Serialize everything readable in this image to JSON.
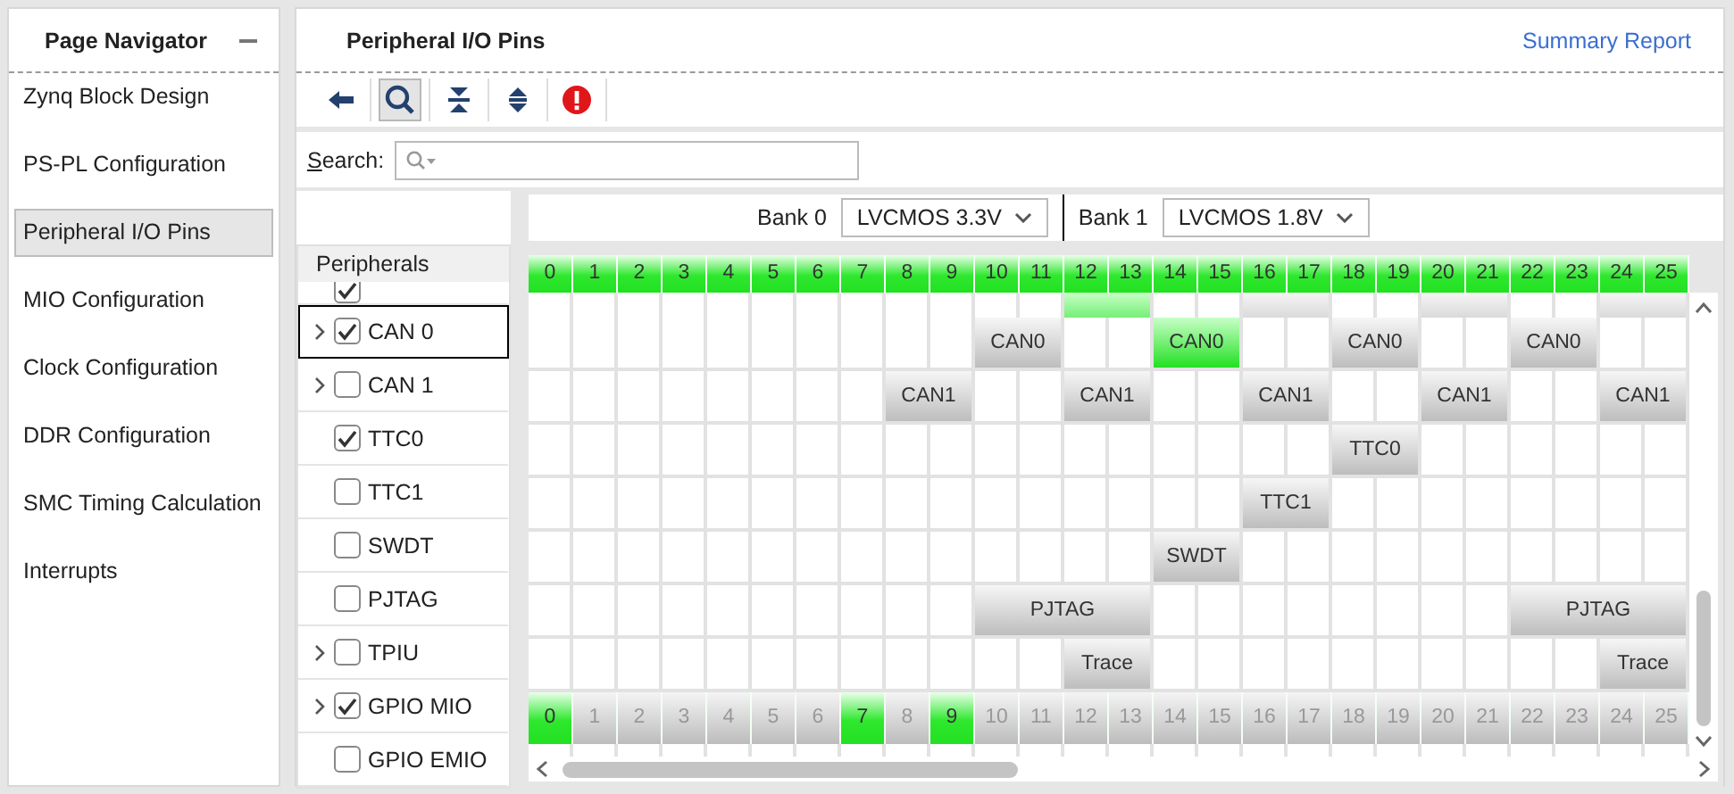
{
  "navigator": {
    "title": "Page Navigator",
    "items": [
      {
        "label": "Zynq Block Design",
        "selected": false
      },
      {
        "label": "PS-PL Configuration",
        "selected": false
      },
      {
        "label": "Peripheral I/O Pins",
        "selected": true
      },
      {
        "label": "MIO Configuration",
        "selected": false
      },
      {
        "label": "Clock Configuration",
        "selected": false
      },
      {
        "label": "DDR Configuration",
        "selected": false
      },
      {
        "label": "SMC Timing Calculation",
        "selected": false
      },
      {
        "label": "Interrupts",
        "selected": false
      }
    ]
  },
  "page": {
    "title": "Peripheral I/O Pins",
    "link": "Summary Report"
  },
  "toolbar": [
    {
      "kind": "back",
      "pressed": false
    },
    {
      "kind": "search",
      "pressed": true
    },
    {
      "kind": "collapse",
      "pressed": false
    },
    {
      "kind": "expand",
      "pressed": false
    },
    {
      "kind": "error",
      "pressed": false
    }
  ],
  "search": {
    "label": "Search:"
  },
  "banks": [
    {
      "label": "Bank 0",
      "value": "LVCMOS 3.3V"
    },
    {
      "label": "Bank 1",
      "value": "LVCMOS 1.8V"
    }
  ],
  "peripherals": {
    "title": "Peripherals",
    "items": [
      {
        "kind": "partial",
        "checked": true,
        "expandable": false,
        "selected": false
      },
      {
        "kind": "row",
        "label": "CAN 0",
        "checked": true,
        "expandable": true,
        "selected": true
      },
      {
        "kind": "row",
        "label": "CAN 1",
        "checked": false,
        "expandable": true,
        "selected": false
      },
      {
        "kind": "row",
        "label": "TTC0",
        "checked": true,
        "expandable": false,
        "selected": false
      },
      {
        "kind": "row",
        "label": "TTC1",
        "checked": false,
        "expandable": false,
        "selected": false
      },
      {
        "kind": "row",
        "label": "SWDT",
        "checked": false,
        "expandable": false,
        "selected": false
      },
      {
        "kind": "row",
        "label": "PJTAG",
        "checked": false,
        "expandable": false,
        "selected": false
      },
      {
        "kind": "row",
        "label": "TPIU",
        "checked": false,
        "expandable": true,
        "selected": false
      },
      {
        "kind": "row",
        "label": "GPIO MIO",
        "checked": true,
        "expandable": true,
        "selected": false
      },
      {
        "kind": "row",
        "label": "GPIO EMIO",
        "checked": false,
        "expandable": false,
        "selected": false
      }
    ]
  },
  "pin_header": [
    {
      "label": "0",
      "active": true
    },
    {
      "label": "1",
      "active": true
    },
    {
      "label": "2",
      "active": true
    },
    {
      "label": "3",
      "active": true
    },
    {
      "label": "4",
      "active": true
    },
    {
      "label": "5",
      "active": true
    },
    {
      "label": "6",
      "active": true
    },
    {
      "label": "7",
      "active": true
    },
    {
      "label": "8",
      "active": true
    },
    {
      "label": "9",
      "active": true
    },
    {
      "label": "10",
      "active": true
    },
    {
      "label": "11",
      "active": true
    },
    {
      "label": "12",
      "active": true
    },
    {
      "label": "13",
      "active": true
    },
    {
      "label": "14",
      "active": true
    },
    {
      "label": "15",
      "active": true
    },
    {
      "label": "16",
      "active": true
    },
    {
      "label": "17",
      "active": true
    },
    {
      "label": "18",
      "active": true
    },
    {
      "label": "19",
      "active": true
    },
    {
      "label": "20",
      "active": true
    },
    {
      "label": "21",
      "active": true
    },
    {
      "label": "22",
      "active": true
    },
    {
      "label": "23",
      "active": true
    },
    {
      "label": "24",
      "active": true
    },
    {
      "label": "25",
      "active": true
    }
  ],
  "rows": [
    {
      "kind": "partial",
      "cells": [
        {
          "kind": "empty"
        },
        {
          "kind": "empty"
        },
        {
          "kind": "empty"
        },
        {
          "kind": "empty"
        },
        {
          "kind": "empty"
        },
        {
          "kind": "empty"
        },
        {
          "kind": "empty"
        },
        {
          "kind": "empty"
        },
        {
          "kind": "empty"
        },
        {
          "kind": "empty"
        },
        {
          "kind": "empty"
        },
        {
          "kind": "empty"
        },
        {
          "kind": "pair",
          "active": true
        },
        {
          "kind": "empty"
        },
        {
          "kind": "empty"
        },
        {
          "kind": "pair",
          "active": false
        },
        {
          "kind": "empty"
        },
        {
          "kind": "empty"
        },
        {
          "kind": "pair",
          "active": false
        },
        {
          "kind": "empty"
        },
        {
          "kind": "empty"
        },
        {
          "kind": "pair",
          "active": false
        }
      ]
    },
    {
      "kind": "row",
      "cells": [
        {
          "kind": "empty"
        },
        {
          "kind": "empty"
        },
        {
          "kind": "empty"
        },
        {
          "kind": "empty"
        },
        {
          "kind": "empty"
        },
        {
          "kind": "empty"
        },
        {
          "kind": "empty"
        },
        {
          "kind": "empty"
        },
        {
          "kind": "empty"
        },
        {
          "kind": "empty"
        },
        {
          "kind": "pair",
          "label": "CAN0",
          "active": false
        },
        {
          "kind": "empty"
        },
        {
          "kind": "empty"
        },
        {
          "kind": "pair",
          "label": "CAN0",
          "active": true
        },
        {
          "kind": "empty"
        },
        {
          "kind": "empty"
        },
        {
          "kind": "pair",
          "label": "CAN0",
          "active": false
        },
        {
          "kind": "empty"
        },
        {
          "kind": "empty"
        },
        {
          "kind": "pair",
          "label": "CAN0",
          "active": false
        },
        {
          "kind": "empty"
        },
        {
          "kind": "empty"
        }
      ]
    },
    {
      "kind": "row",
      "cells": [
        {
          "kind": "empty"
        },
        {
          "kind": "empty"
        },
        {
          "kind": "empty"
        },
        {
          "kind": "empty"
        },
        {
          "kind": "empty"
        },
        {
          "kind": "empty"
        },
        {
          "kind": "empty"
        },
        {
          "kind": "empty"
        },
        {
          "kind": "pair",
          "label": "CAN1",
          "active": false
        },
        {
          "kind": "empty"
        },
        {
          "kind": "empty"
        },
        {
          "kind": "pair",
          "label": "CAN1",
          "active": false
        },
        {
          "kind": "empty"
        },
        {
          "kind": "empty"
        },
        {
          "kind": "pair",
          "label": "CAN1",
          "active": false
        },
        {
          "kind": "empty"
        },
        {
          "kind": "empty"
        },
        {
          "kind": "pair",
          "label": "CAN1",
          "active": false
        },
        {
          "kind": "empty"
        },
        {
          "kind": "empty"
        },
        {
          "kind": "pair",
          "label": "CAN1",
          "active": false
        }
      ]
    },
    {
      "kind": "row",
      "cells": [
        {
          "kind": "empty"
        },
        {
          "kind": "empty"
        },
        {
          "kind": "empty"
        },
        {
          "kind": "empty"
        },
        {
          "kind": "empty"
        },
        {
          "kind": "empty"
        },
        {
          "kind": "empty"
        },
        {
          "kind": "empty"
        },
        {
          "kind": "empty"
        },
        {
          "kind": "empty"
        },
        {
          "kind": "empty"
        },
        {
          "kind": "empty"
        },
        {
          "kind": "empty"
        },
        {
          "kind": "empty"
        },
        {
          "kind": "empty"
        },
        {
          "kind": "empty"
        },
        {
          "kind": "empty"
        },
        {
          "kind": "empty"
        },
        {
          "kind": "pair",
          "label": "TTC0",
          "active": false
        },
        {
          "kind": "empty"
        },
        {
          "kind": "empty"
        },
        {
          "kind": "empty"
        },
        {
          "kind": "empty"
        },
        {
          "kind": "empty"
        },
        {
          "kind": "empty"
        }
      ]
    },
    {
      "kind": "row",
      "cells": [
        {
          "kind": "empty"
        },
        {
          "kind": "empty"
        },
        {
          "kind": "empty"
        },
        {
          "kind": "empty"
        },
        {
          "kind": "empty"
        },
        {
          "kind": "empty"
        },
        {
          "kind": "empty"
        },
        {
          "kind": "empty"
        },
        {
          "kind": "empty"
        },
        {
          "kind": "empty"
        },
        {
          "kind": "empty"
        },
        {
          "kind": "empty"
        },
        {
          "kind": "empty"
        },
        {
          "kind": "empty"
        },
        {
          "kind": "empty"
        },
        {
          "kind": "empty"
        },
        {
          "kind": "pair",
          "label": "TTC1",
          "active": false
        },
        {
          "kind": "empty"
        },
        {
          "kind": "empty"
        },
        {
          "kind": "empty"
        },
        {
          "kind": "empty"
        },
        {
          "kind": "empty"
        },
        {
          "kind": "empty"
        },
        {
          "kind": "empty"
        },
        {
          "kind": "empty"
        }
      ]
    },
    {
      "kind": "row",
      "cells": [
        {
          "kind": "empty"
        },
        {
          "kind": "empty"
        },
        {
          "kind": "empty"
        },
        {
          "kind": "empty"
        },
        {
          "kind": "empty"
        },
        {
          "kind": "empty"
        },
        {
          "kind": "empty"
        },
        {
          "kind": "empty"
        },
        {
          "kind": "empty"
        },
        {
          "kind": "empty"
        },
        {
          "kind": "empty"
        },
        {
          "kind": "empty"
        },
        {
          "kind": "empty"
        },
        {
          "kind": "empty"
        },
        {
          "kind": "pair",
          "label": "SWDT",
          "active": false
        },
        {
          "kind": "empty"
        },
        {
          "kind": "empty"
        },
        {
          "kind": "empty"
        },
        {
          "kind": "empty"
        },
        {
          "kind": "empty"
        },
        {
          "kind": "empty"
        },
        {
          "kind": "empty"
        },
        {
          "kind": "empty"
        },
        {
          "kind": "empty"
        },
        {
          "kind": "empty"
        }
      ]
    },
    {
      "kind": "row",
      "cells": [
        {
          "kind": "empty"
        },
        {
          "kind": "empty"
        },
        {
          "kind": "empty"
        },
        {
          "kind": "empty"
        },
        {
          "kind": "empty"
        },
        {
          "kind": "empty"
        },
        {
          "kind": "empty"
        },
        {
          "kind": "empty"
        },
        {
          "kind": "empty"
        },
        {
          "kind": "empty"
        },
        {
          "kind": "quad",
          "label": "PJTAG",
          "active": false
        },
        {
          "kind": "empty"
        },
        {
          "kind": "empty"
        },
        {
          "kind": "empty"
        },
        {
          "kind": "empty"
        },
        {
          "kind": "empty"
        },
        {
          "kind": "empty"
        },
        {
          "kind": "empty"
        },
        {
          "kind": "empty"
        },
        {
          "kind": "quad",
          "label": "PJTAG",
          "active": false
        }
      ]
    },
    {
      "kind": "row",
      "cells": [
        {
          "kind": "empty"
        },
        {
          "kind": "empty"
        },
        {
          "kind": "empty"
        },
        {
          "kind": "empty"
        },
        {
          "kind": "empty"
        },
        {
          "kind": "empty"
        },
        {
          "kind": "empty"
        },
        {
          "kind": "empty"
        },
        {
          "kind": "empty"
        },
        {
          "kind": "empty"
        },
        {
          "kind": "empty"
        },
        {
          "kind": "empty"
        },
        {
          "kind": "pair",
          "label": "Trace",
          "active": false
        },
        {
          "kind": "empty"
        },
        {
          "kind": "empty"
        },
        {
          "kind": "empty"
        },
        {
          "kind": "empty"
        },
        {
          "kind": "empty"
        },
        {
          "kind": "empty"
        },
        {
          "kind": "empty"
        },
        {
          "kind": "empty"
        },
        {
          "kind": "empty"
        },
        {
          "kind": "empty"
        },
        {
          "kind": "pair",
          "label": "Trace",
          "active": false
        }
      ]
    }
  ],
  "pin_footer": [
    {
      "label": "0",
      "active": true
    },
    {
      "label": "1",
      "active": false
    },
    {
      "label": "2",
      "active": false
    },
    {
      "label": "3",
      "active": false
    },
    {
      "label": "4",
      "active": false
    },
    {
      "label": "5",
      "active": false
    },
    {
      "label": "6",
      "active": false
    },
    {
      "label": "7",
      "active": true
    },
    {
      "label": "8",
      "active": false
    },
    {
      "label": "9",
      "active": true
    },
    {
      "label": "10",
      "active": false
    },
    {
      "label": "11",
      "active": false
    },
    {
      "label": "12",
      "active": false
    },
    {
      "label": "13",
      "active": false
    },
    {
      "label": "14",
      "active": false
    },
    {
      "label": "15",
      "active": false
    },
    {
      "label": "16",
      "active": false
    },
    {
      "label": "17",
      "active": false
    },
    {
      "label": "18",
      "active": false
    },
    {
      "label": "19",
      "active": false
    },
    {
      "label": "20",
      "active": false
    },
    {
      "label": "21",
      "active": false
    },
    {
      "label": "22",
      "active": false
    },
    {
      "label": "23",
      "active": false
    },
    {
      "label": "24",
      "active": false
    },
    {
      "label": "25",
      "active": false
    }
  ]
}
